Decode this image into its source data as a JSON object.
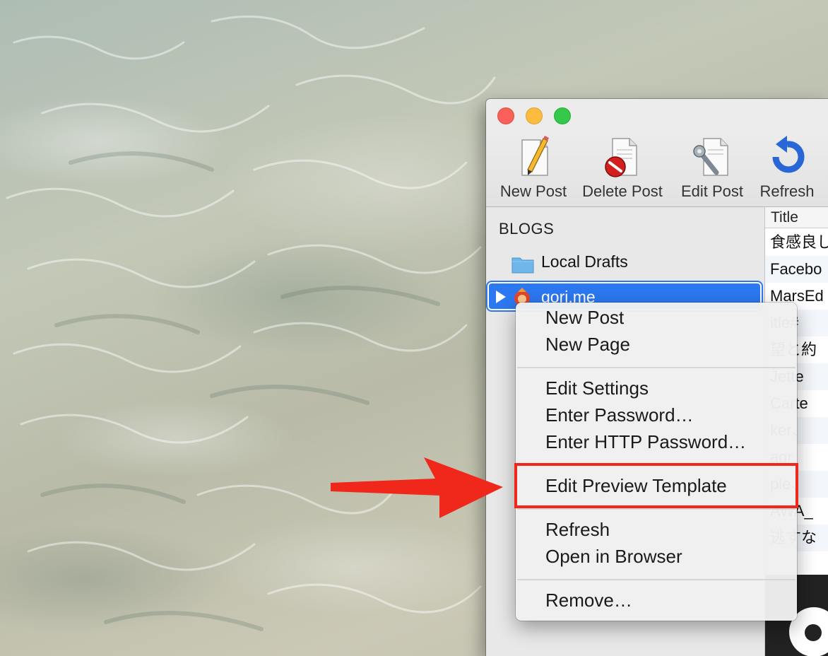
{
  "toolbar": {
    "new_post": "New Post",
    "delete_post": "Delete Post",
    "edit_post": "Edit Post",
    "refresh": "Refresh"
  },
  "sidebar": {
    "header": "BLOGS",
    "local_drafts": "Local Drafts",
    "blog_name": "gori.me"
  },
  "post_list": {
    "column_title": "Title",
    "rows": [
      "食感良し",
      "Facebo",
      "MarsEd",
      "itle#",
      "望と約",
      "Jette",
      "Carte",
      "ker、",
      "agr",
      "ple、",
      "AWA_",
      "逃すな"
    ]
  },
  "context_menu": {
    "new_post": "New Post",
    "new_page": "New Page",
    "edit_settings": "Edit Settings",
    "enter_password": "Enter Password…",
    "enter_http_password": "Enter HTTP Password…",
    "edit_preview_template": "Edit Preview Template",
    "refresh": "Refresh",
    "open_in_browser": "Open in Browser",
    "remove": "Remove…"
  },
  "colors": {
    "selection": "#2c78f0",
    "annotation_red": "#f0281c"
  }
}
